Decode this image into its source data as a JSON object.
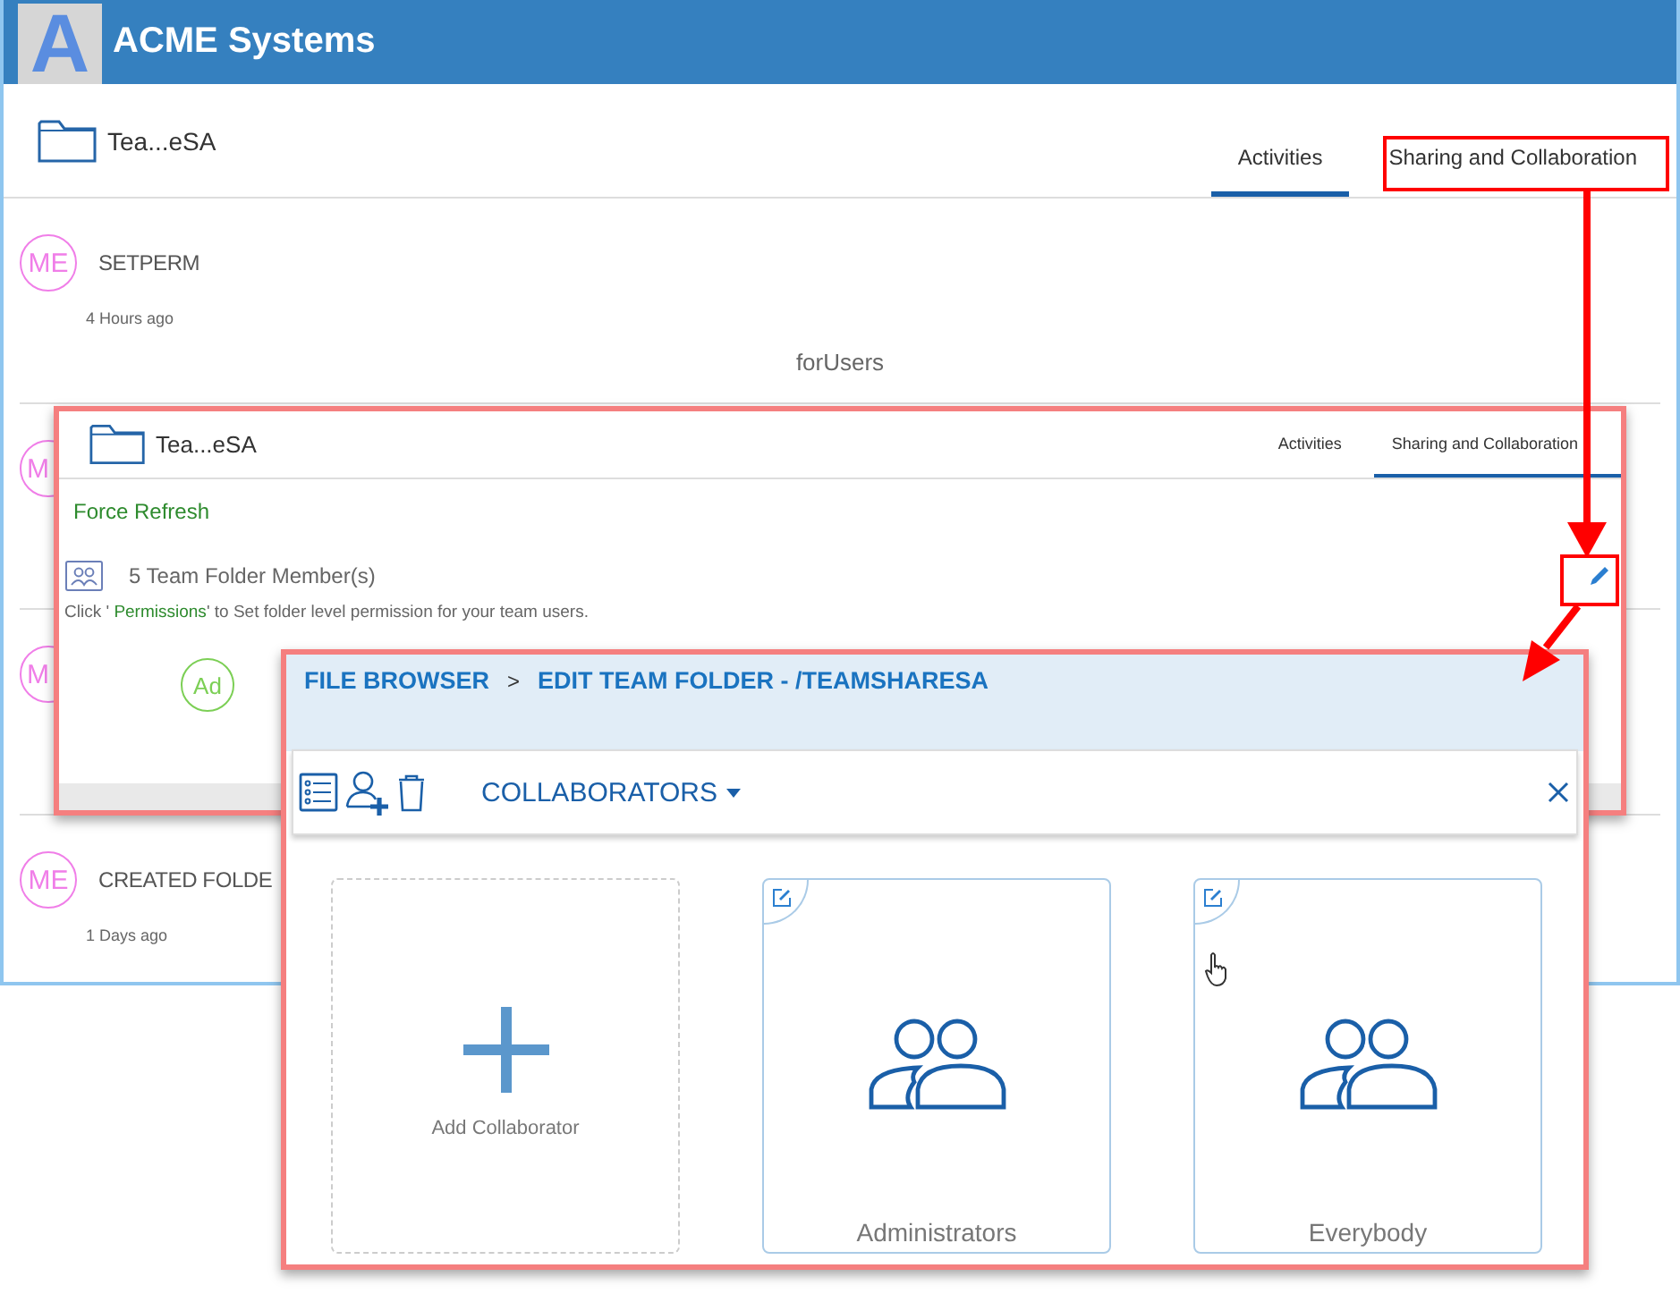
{
  "header": {
    "logo_letter": "A",
    "title": "ACME Systems"
  },
  "folder": {
    "name": "Tea...eSA"
  },
  "tabs": [
    {
      "label": "Activities",
      "selected": true
    },
    {
      "label": "Sharing and Collaboration",
      "selected": false
    }
  ],
  "activities": [
    {
      "avatar": "ME",
      "action": "SETPERM",
      "time": "4 Hours ago",
      "detail": "forUsers"
    },
    {
      "avatar": "M"
    },
    {
      "avatar": "M"
    },
    {
      "avatar": "ME",
      "action": "CREATED FOLDE",
      "time": "1 Days ago"
    }
  ],
  "sharing_panel": {
    "folder_name": "Tea...eSA",
    "tabs": [
      {
        "label": "Activities",
        "selected": false
      },
      {
        "label": "Sharing and Collaboration",
        "selected": true
      }
    ],
    "force_refresh": "Force Refresh",
    "members": "5 Team Folder Member(s)",
    "hint_before": "Click '",
    "hint_link": "Permissions",
    "hint_after": "' to Set folder level permission for your team users.",
    "avatar": "Ad"
  },
  "editor": {
    "breadcrumb": [
      {
        "label": "FILE BROWSER"
      },
      {
        "label": "EDIT TEAM FOLDER - /TEAMSHARESA"
      }
    ],
    "separator": ">",
    "toolbar_title": "COLLABORATORS",
    "cards": [
      {
        "kind": "add",
        "label": "Add Collaborator"
      },
      {
        "kind": "group",
        "label": "Administrators"
      },
      {
        "kind": "group",
        "label": "Everybody"
      }
    ]
  }
}
